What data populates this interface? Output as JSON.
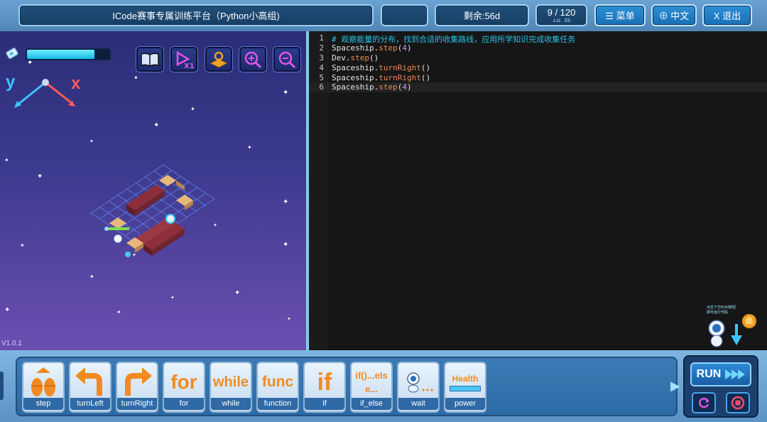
{
  "topbar": {
    "title": "ICode赛事专属训练平台（Python小高组)",
    "remaining": "剩余:56d",
    "progress": "9 / 120",
    "progress_sub1": "♙11",
    "progress_sub2": "☰5",
    "menu_label": "☰ 菜单",
    "lang_label": "⊕ 中文",
    "exit_label": "X 退出"
  },
  "game": {
    "version": "V1.0.1",
    "axis_y": "y",
    "axis_x": "x",
    "energy_level": 0.82,
    "tools": [
      "book-icon",
      "speed-x1-icon",
      "map-icon",
      "zoom-in-icon",
      "zoom-out-icon"
    ]
  },
  "editor": {
    "lines": [
      {
        "n": "1",
        "comment": "# 观察能量的分布，找到合适的收集路线，应用所学知识完成收集任务"
      },
      {
        "n": "2",
        "obj": "Spaceship.",
        "fn": "step",
        "open": "(",
        "arg": "4",
        "close": ")"
      },
      {
        "n": "3",
        "obj": "Dev.",
        "fn": "step",
        "open": "()",
        "arg": "",
        "close": ""
      },
      {
        "n": "4",
        "obj": "Spaceship.",
        "fn": "turnRight",
        "open": "()",
        "arg": "",
        "close": ""
      },
      {
        "n": "5",
        "obj": "Spaceship.",
        "fn": "turnRight",
        "open": "()",
        "arg": "",
        "close": ""
      },
      {
        "n": "6",
        "obj": "Spaceship.",
        "fn": "step",
        "open": "(",
        "arg": "4",
        "close": ")"
      }
    ],
    "helper_tip_1": "点击下方RUN按钮",
    "helper_tip_2": "即可运行代码"
  },
  "blocks": [
    {
      "id": "step",
      "art": "",
      "label": "step"
    },
    {
      "id": "turnLeft",
      "art": "",
      "label": "turnLeft"
    },
    {
      "id": "turnRight",
      "art": "",
      "label": "turnRight"
    },
    {
      "id": "for",
      "art": "for",
      "label": "for"
    },
    {
      "id": "while",
      "art": "while",
      "label": "while"
    },
    {
      "id": "function",
      "art": "func",
      "label": "function"
    },
    {
      "id": "if",
      "art": "if",
      "label": "if"
    },
    {
      "id": "if_else",
      "art": "if()...else...",
      "label": "if_else"
    },
    {
      "id": "wait",
      "art": "",
      "label": "wait"
    },
    {
      "id": "power",
      "art": "Health",
      "label": "power"
    }
  ],
  "run": {
    "label": "RUN"
  }
}
